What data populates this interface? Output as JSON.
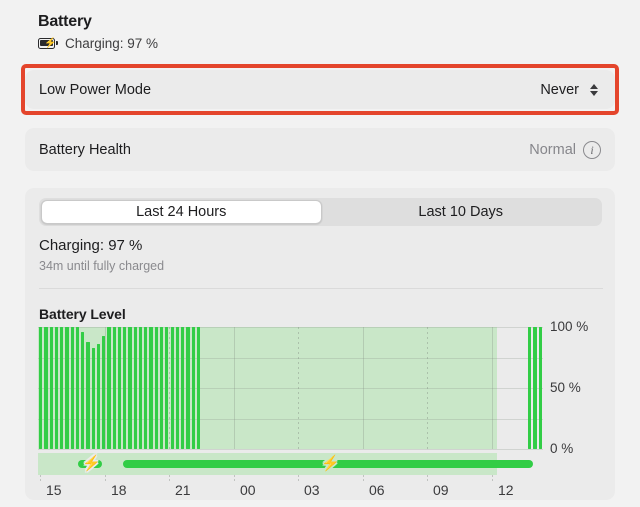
{
  "header": {
    "title": "Battery",
    "status": "Charging: 97 %",
    "battery_icon": "battery-charging-icon"
  },
  "rows": {
    "low_power_mode": {
      "label": "Low Power Mode",
      "value": "Never",
      "control_icon": "chevron-up-down-icon",
      "highlight_color": "#e4452c"
    },
    "battery_health": {
      "label": "Battery Health",
      "value": "Normal",
      "info_icon": "info-circle-icon",
      "info_glyph": "i"
    }
  },
  "segmented": {
    "tabs": [
      {
        "label": "Last 24 Hours",
        "selected": true
      },
      {
        "label": "Last 10 Days",
        "selected": false
      }
    ]
  },
  "status": {
    "main": "Charging: 97 %",
    "sub": "34m until fully charged"
  },
  "chart_data": {
    "type": "bar",
    "title": "Battery Level",
    "xlabel": "",
    "ylabel": "",
    "ylim": [
      0,
      100
    ],
    "ytick_labels": [
      "100 %",
      "50 %",
      "0 %"
    ],
    "yticks": [
      100,
      50,
      0
    ],
    "xtick_labels": [
      "15",
      "18",
      "21",
      "00",
      "03",
      "06",
      "09",
      "12"
    ],
    "grid": true,
    "bar_color": "#32cd46",
    "shade_color": "#c9e7c8",
    "series": [
      {
        "name": "Battery Level",
        "values": [
          100,
          100,
          100,
          100,
          100,
          100,
          100,
          100,
          96,
          88,
          83,
          86,
          93,
          100,
          100,
          100,
          100,
          100,
          100,
          100,
          100,
          100,
          100,
          100,
          100,
          100,
          100,
          100,
          100,
          100,
          100,
          null,
          null,
          null,
          null,
          null,
          null,
          null,
          null,
          null,
          null,
          null,
          null,
          null,
          null,
          null,
          null,
          null,
          null,
          null,
          null,
          null,
          null,
          null,
          null,
          null,
          null,
          null,
          null,
          null,
          null,
          null,
          null,
          null,
          null,
          null,
          null,
          null,
          null,
          null,
          null,
          null,
          null,
          null,
          null,
          null,
          null,
          null,
          null,
          null,
          null,
          null,
          null,
          null,
          null,
          null,
          null,
          null,
          null,
          null,
          null,
          null,
          null,
          100,
          100,
          100
        ]
      }
    ],
    "charging_periods": [
      {
        "label": "charging-start",
        "bolt": true
      },
      {
        "label": "charging-main",
        "bolt": true
      }
    ]
  }
}
